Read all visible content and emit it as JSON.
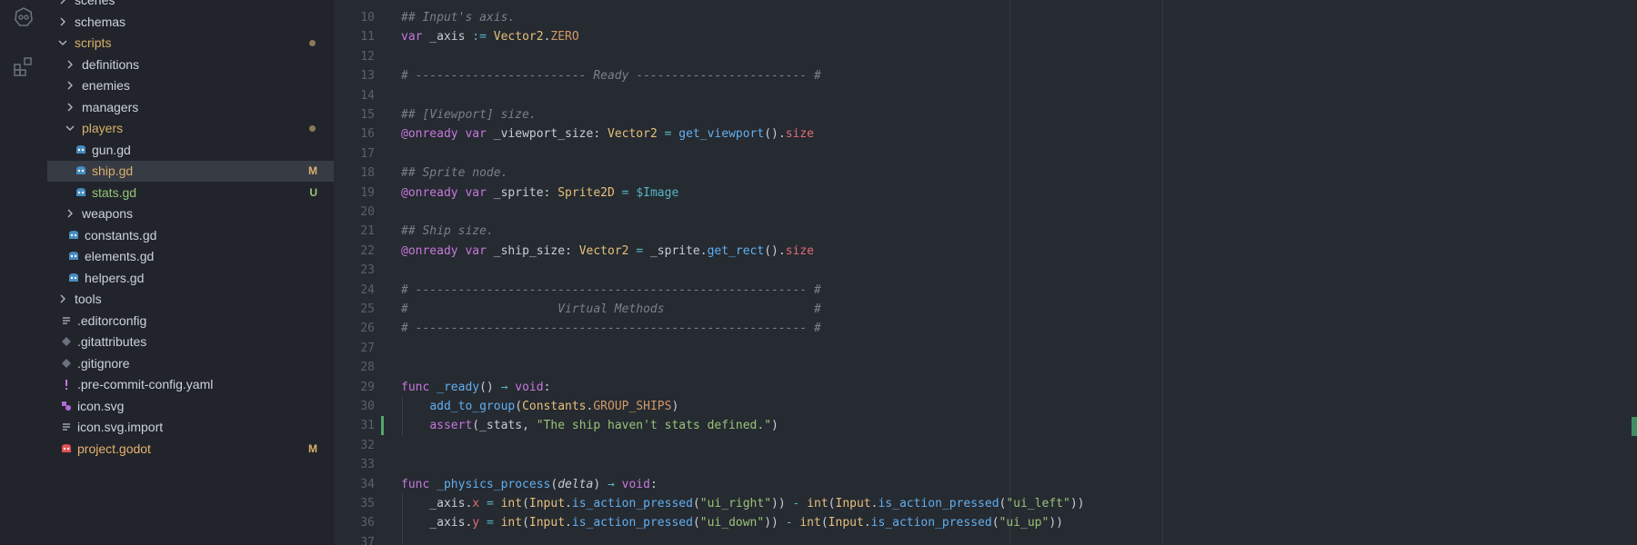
{
  "activity": {
    "icons": [
      "godot-logo-icon",
      "extensions-icon"
    ]
  },
  "explorer": {
    "items": [
      {
        "label": "scenes",
        "kind": "folder",
        "open": false,
        "depth": 1
      },
      {
        "label": "schemas",
        "kind": "folder",
        "open": false,
        "depth": 1
      },
      {
        "label": "scripts",
        "kind": "folder",
        "open": true,
        "depth": 1,
        "status": "dot"
      },
      {
        "label": "definitions",
        "kind": "folder",
        "open": false,
        "depth": 2
      },
      {
        "label": "enemies",
        "kind": "folder",
        "open": false,
        "depth": 2
      },
      {
        "label": "managers",
        "kind": "folder",
        "open": false,
        "depth": 2
      },
      {
        "label": "players",
        "kind": "folder",
        "open": true,
        "depth": 2,
        "status": "dot"
      },
      {
        "label": "gun.gd",
        "kind": "gd",
        "depth": 3
      },
      {
        "label": "ship.gd",
        "kind": "gd",
        "depth": 3,
        "badge": "M",
        "selected": true
      },
      {
        "label": "stats.gd",
        "kind": "gd",
        "depth": 3,
        "badge": "U"
      },
      {
        "label": "weapons",
        "kind": "folder",
        "open": false,
        "depth": 2
      },
      {
        "label": "constants.gd",
        "kind": "gd",
        "depth": 2
      },
      {
        "label": "elements.gd",
        "kind": "gd",
        "depth": 2
      },
      {
        "label": "helpers.gd",
        "kind": "gd",
        "depth": 2
      },
      {
        "label": "tools",
        "kind": "folder",
        "open": false,
        "depth": 1
      },
      {
        "label": ".editorconfig",
        "kind": "lines",
        "depth": 1
      },
      {
        "label": ".gitattributes",
        "kind": "git",
        "depth": 1
      },
      {
        "label": ".gitignore",
        "kind": "git",
        "depth": 1
      },
      {
        "label": ".pre-commit-config.yaml",
        "kind": "yaml",
        "depth": 1
      },
      {
        "label": "icon.svg",
        "kind": "svg",
        "depth": 1
      },
      {
        "label": "icon.svg.import",
        "kind": "lines",
        "depth": 1
      },
      {
        "label": "project.godot",
        "kind": "godot",
        "depth": 1,
        "badge": "M"
      }
    ]
  },
  "editor": {
    "lines": [
      {
        "n": "10",
        "tokens": [
          [
            "cm",
            "## Input's axis."
          ]
        ]
      },
      {
        "n": "11",
        "tokens": [
          [
            "kw",
            "var"
          ],
          [
            "",
            " _axis "
          ],
          [
            "op",
            ":="
          ],
          [
            "",
            " "
          ],
          [
            "ty",
            "Vector2"
          ],
          [
            "",
            "."
          ],
          [
            "cn",
            "ZERO"
          ]
        ]
      },
      {
        "n": "12",
        "tokens": []
      },
      {
        "n": "13",
        "tokens": [
          [
            "cm",
            "# ------------------------ Ready ------------------------ #"
          ]
        ]
      },
      {
        "n": "14",
        "tokens": []
      },
      {
        "n": "15",
        "tokens": [
          [
            "cm",
            "## [Viewport] size."
          ]
        ]
      },
      {
        "n": "16",
        "tokens": [
          [
            "an",
            "@onready"
          ],
          [
            "",
            " "
          ],
          [
            "kw",
            "var"
          ],
          [
            "",
            " _viewport_size: "
          ],
          [
            "ty",
            "Vector2"
          ],
          [
            "",
            " "
          ],
          [
            "op",
            "="
          ],
          [
            "",
            " "
          ],
          [
            "fn",
            "get_viewport"
          ],
          [
            "",
            "()."
          ],
          [
            "pr",
            "size"
          ]
        ]
      },
      {
        "n": "17",
        "tokens": []
      },
      {
        "n": "18",
        "tokens": [
          [
            "cm",
            "## Sprite node."
          ]
        ]
      },
      {
        "n": "19",
        "tokens": [
          [
            "an",
            "@onready"
          ],
          [
            "",
            " "
          ],
          [
            "kw",
            "var"
          ],
          [
            "",
            " _sprite: "
          ],
          [
            "ty",
            "Sprite2D"
          ],
          [
            "",
            " "
          ],
          [
            "op",
            "="
          ],
          [
            "",
            " "
          ],
          [
            "nd",
            "$Image"
          ]
        ]
      },
      {
        "n": "20",
        "tokens": []
      },
      {
        "n": "21",
        "tokens": [
          [
            "cm",
            "## Ship size."
          ]
        ]
      },
      {
        "n": "22",
        "tokens": [
          [
            "an",
            "@onready"
          ],
          [
            "",
            " "
          ],
          [
            "kw",
            "var"
          ],
          [
            "",
            " _ship_size: "
          ],
          [
            "ty",
            "Vector2"
          ],
          [
            "",
            " "
          ],
          [
            "op",
            "="
          ],
          [
            "",
            " _sprite."
          ],
          [
            "fn",
            "get_rect"
          ],
          [
            "",
            "()."
          ],
          [
            "pr",
            "size"
          ]
        ]
      },
      {
        "n": "23",
        "tokens": []
      },
      {
        "n": "24",
        "tokens": [
          [
            "cm",
            "# ------------------------------------------------------- #"
          ]
        ]
      },
      {
        "n": "25",
        "tokens": [
          [
            "cm",
            "#                     Virtual Methods                     #"
          ]
        ]
      },
      {
        "n": "26",
        "tokens": [
          [
            "cm",
            "# ------------------------------------------------------- #"
          ]
        ]
      },
      {
        "n": "27",
        "tokens": []
      },
      {
        "n": "28",
        "tokens": []
      },
      {
        "n": "29",
        "tokens": [
          [
            "kw",
            "func"
          ],
          [
            "",
            " "
          ],
          [
            "fn",
            "_ready"
          ],
          [
            "",
            "() "
          ],
          [
            "op",
            "→"
          ],
          [
            "",
            " "
          ],
          [
            "kw",
            "void"
          ],
          [
            "",
            ":"
          ]
        ]
      },
      {
        "n": "30",
        "tokens": [
          [
            "",
            "    "
          ],
          [
            "fn",
            "add_to_group"
          ],
          [
            "",
            "("
          ],
          [
            "ty",
            "Constants"
          ],
          [
            "",
            "."
          ],
          [
            "cn",
            "GROUP_SHIPS"
          ],
          [
            "",
            ")"
          ]
        ]
      },
      {
        "n": "31",
        "tokens": [
          [
            "",
            "    "
          ],
          [
            "kw",
            "assert"
          ],
          [
            "",
            "(_stats, "
          ],
          [
            "st",
            "\"The ship haven't stats defined.\""
          ],
          [
            "",
            ")"
          ]
        ],
        "git": true
      },
      {
        "n": "32",
        "tokens": []
      },
      {
        "n": "33",
        "tokens": []
      },
      {
        "n": "34",
        "tokens": [
          [
            "kw",
            "func"
          ],
          [
            "",
            " "
          ],
          [
            "fn",
            "_physics_process"
          ],
          [
            "",
            "("
          ],
          [
            "pm",
            "delta"
          ],
          [
            "",
            ") "
          ],
          [
            "op",
            "→"
          ],
          [
            "",
            " "
          ],
          [
            "kw",
            "void"
          ],
          [
            "",
            ":"
          ]
        ]
      },
      {
        "n": "35",
        "tokens": [
          [
            "",
            "    _axis."
          ],
          [
            "pr",
            "x"
          ],
          [
            "",
            " "
          ],
          [
            "op",
            "="
          ],
          [
            "",
            " "
          ],
          [
            "ty",
            "int"
          ],
          [
            "",
            "("
          ],
          [
            "ty",
            "Input"
          ],
          [
            "",
            "."
          ],
          [
            "fn",
            "is_action_pressed"
          ],
          [
            "",
            "("
          ],
          [
            "st",
            "\"ui_right\""
          ],
          [
            "",
            ")) "
          ],
          [
            "op",
            "-"
          ],
          [
            "",
            " "
          ],
          [
            "ty",
            "int"
          ],
          [
            "",
            "("
          ],
          [
            "ty",
            "Input"
          ],
          [
            "",
            "."
          ],
          [
            "fn",
            "is_action_pressed"
          ],
          [
            "",
            "("
          ],
          [
            "st",
            "\"ui_left\""
          ],
          [
            "",
            "))"
          ]
        ]
      },
      {
        "n": "36",
        "tokens": [
          [
            "",
            "    _axis."
          ],
          [
            "pr",
            "y"
          ],
          [
            "",
            " "
          ],
          [
            "op",
            "="
          ],
          [
            "",
            " "
          ],
          [
            "ty",
            "int"
          ],
          [
            "",
            "("
          ],
          [
            "ty",
            "Input"
          ],
          [
            "",
            "."
          ],
          [
            "fn",
            "is_action_pressed"
          ],
          [
            "",
            "("
          ],
          [
            "st",
            "\"ui_down\""
          ],
          [
            "",
            ")) "
          ],
          [
            "op",
            "-"
          ],
          [
            "",
            " "
          ],
          [
            "ty",
            "int"
          ],
          [
            "",
            "("
          ],
          [
            "ty",
            "Input"
          ],
          [
            "",
            "."
          ],
          [
            "fn",
            "is_action_pressed"
          ],
          [
            "",
            "("
          ],
          [
            "st",
            "\"ui_up\""
          ],
          [
            "",
            "))"
          ]
        ]
      },
      {
        "n": "37",
        "tokens": []
      }
    ]
  }
}
